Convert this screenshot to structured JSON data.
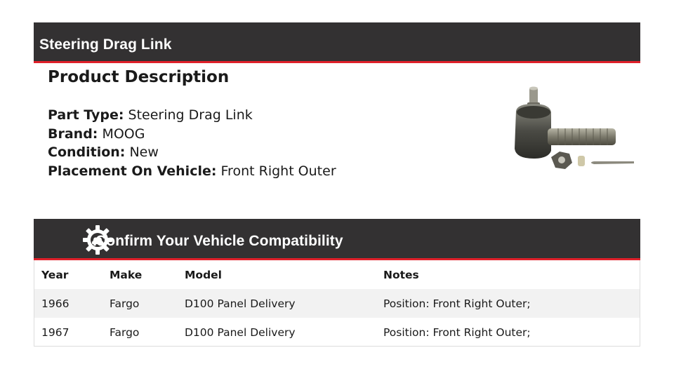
{
  "product_section": {
    "title": "Steering Drag Link",
    "heading": "Product Description",
    "specs": [
      {
        "key": "Part Type:",
        "value": "Steering Drag Link"
      },
      {
        "key": "Brand:",
        "value": "MOOG"
      },
      {
        "key": "Condition:",
        "value": "New"
      },
      {
        "key": "Placement On Vehicle:",
        "value": "Front Right Outer"
      }
    ],
    "image_icon": "tie-rod-end-product-image"
  },
  "compat_section": {
    "title": "Confirm Your Vehicle Compatibility",
    "icon": "gear-car-icon",
    "columns": [
      "Year",
      "Make",
      "Model",
      "Notes"
    ],
    "rows": [
      {
        "year": "1966",
        "make": "Fargo",
        "model": "D100 Panel Delivery",
        "notes": "Position: Front Right Outer;"
      },
      {
        "year": "1967",
        "make": "Fargo",
        "model": "D100 Panel Delivery",
        "notes": "Position: Front Right Outer;"
      }
    ]
  },
  "colors": {
    "bar_background": "#333132",
    "bar_accent": "#e0202a",
    "stripe_row": "#f2f2f2"
  }
}
